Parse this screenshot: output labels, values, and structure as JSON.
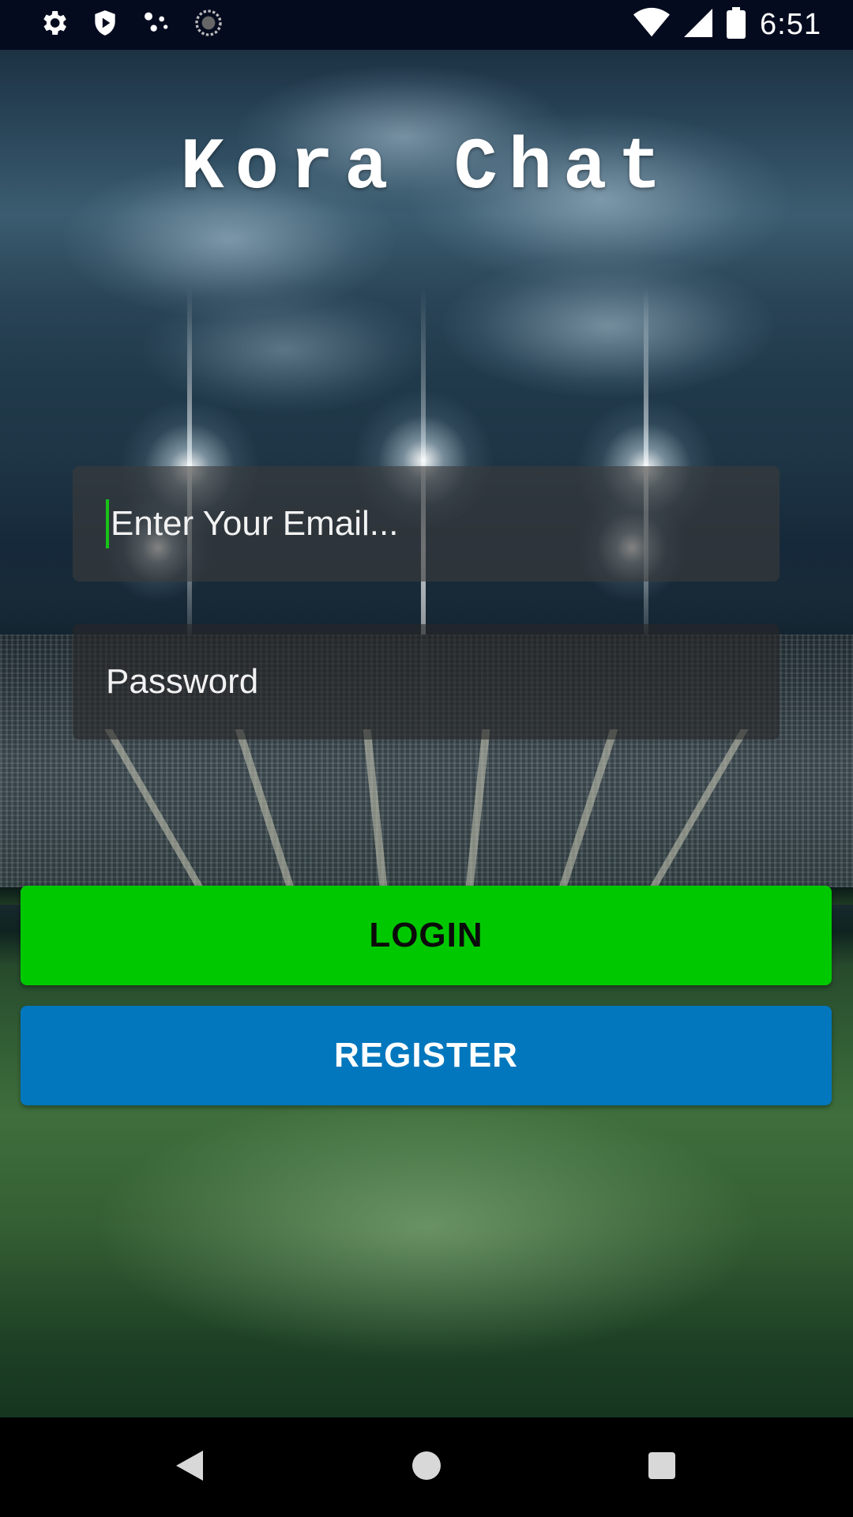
{
  "status_bar": {
    "time": "6:51",
    "left_icons": [
      "settings-icon",
      "shield-icon",
      "dots-icon",
      "sync-icon"
    ],
    "right_icons": [
      "wifi-icon",
      "signal-icon",
      "battery-icon"
    ]
  },
  "app": {
    "title": "Kora Chat"
  },
  "form": {
    "email_placeholder": "Enter Your Email...",
    "email_value": "",
    "password_placeholder": "Password",
    "password_value": ""
  },
  "buttons": {
    "login_label": "LOGIN",
    "register_label": "REGISTER"
  },
  "colors": {
    "login_button": "#00C800",
    "register_button": "#0277BD",
    "caret": "#18C218",
    "status_bar": "#050B1F"
  },
  "nav_bar": {
    "icons": [
      "back-icon",
      "home-icon",
      "recents-icon"
    ]
  }
}
